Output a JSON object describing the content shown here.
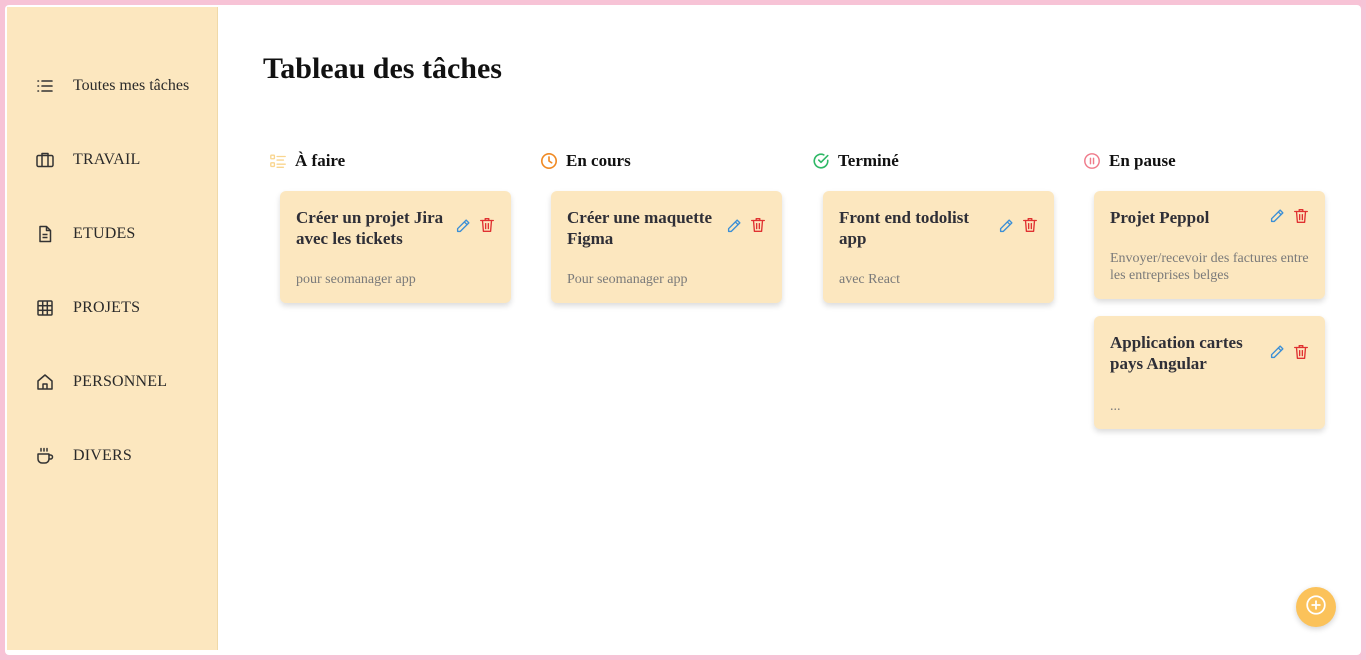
{
  "sidebar": {
    "items": [
      {
        "label": "Toutes mes tâches",
        "icon": "list-icon"
      },
      {
        "label": "TRAVAIL",
        "icon": "briefcase-icon"
      },
      {
        "label": "ETUDES",
        "icon": "document-icon"
      },
      {
        "label": "PROJETS",
        "icon": "grid-icon"
      },
      {
        "label": "PERSONNEL",
        "icon": "home-icon"
      },
      {
        "label": "DIVERS",
        "icon": "coffee-icon"
      }
    ]
  },
  "main": {
    "title": "Tableau des tâches",
    "columns": [
      {
        "label": "À faire",
        "icon": "todo-list-icon",
        "color": "#f9d58f"
      },
      {
        "label": "En cours",
        "icon": "clock-icon",
        "color": "#f08a24"
      },
      {
        "label": "Terminé",
        "icon": "check-circle-icon",
        "color": "#2fb866"
      },
      {
        "label": "En pause",
        "icon": "pause-circle-icon",
        "color": "#ef7a8a"
      }
    ],
    "cards": [
      {
        "title": "Créer un projet Jira avec les tickets",
        "desc": "pour seomanager app"
      },
      {
        "title": "Créer une maquette Figma",
        "desc": "Pour seomanager app"
      },
      {
        "title": "Front end todolist app",
        "desc": "avec React"
      },
      {
        "title": "Projet Peppol",
        "desc": "Envoyer/recevoir des factures entre les entreprises belges"
      },
      {
        "title": "Application cartes pays Angular",
        "desc": "..."
      }
    ]
  },
  "colors": {
    "sidebar_bg": "#fce7bf",
    "card_bg": "#fce7bf",
    "edit_icon": "#3b8fd6",
    "delete_icon": "#e03131",
    "fab": "#fbc25a",
    "page_border": "#f7c3d6"
  },
  "fab": {
    "icon": "plus-circle-icon"
  }
}
